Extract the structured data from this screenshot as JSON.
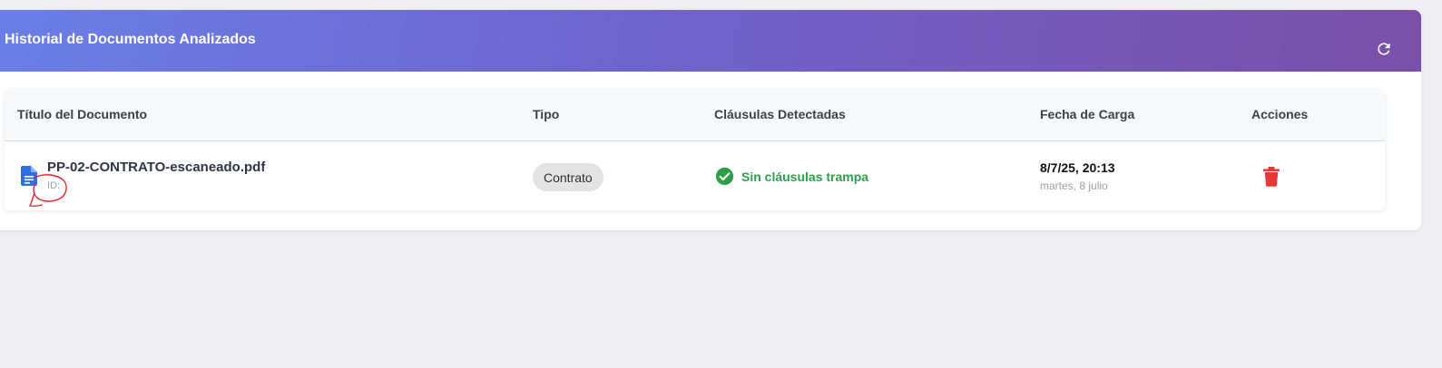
{
  "header": {
    "title": "Historial de Documentos Analizados",
    "refresh_icon": "refresh-icon"
  },
  "table": {
    "columns": [
      "Título del Documento",
      "Tipo",
      "Cláusulas Detectadas",
      "Fecha de Carga",
      "Acciones"
    ],
    "rows": [
      {
        "icon": "document-icon",
        "title": "PP-02-CONTRATO-escaneado.pdf",
        "id_label": "ID:",
        "type": "Contrato",
        "status_icon": "check-circle-icon",
        "status": "Sin cláusulas trampa",
        "date": "8/7/25, 20:13",
        "date_long": "martes, 8 julio",
        "action_icon": "trash-icon"
      }
    ]
  },
  "colors": {
    "header_gradient_start": "#6a7fe6",
    "header_gradient_end": "#7a4fa8",
    "success": "#2e9e4b",
    "danger": "#e53935",
    "doc_icon": "#2f6fe0",
    "annotation": "#e0232a"
  }
}
